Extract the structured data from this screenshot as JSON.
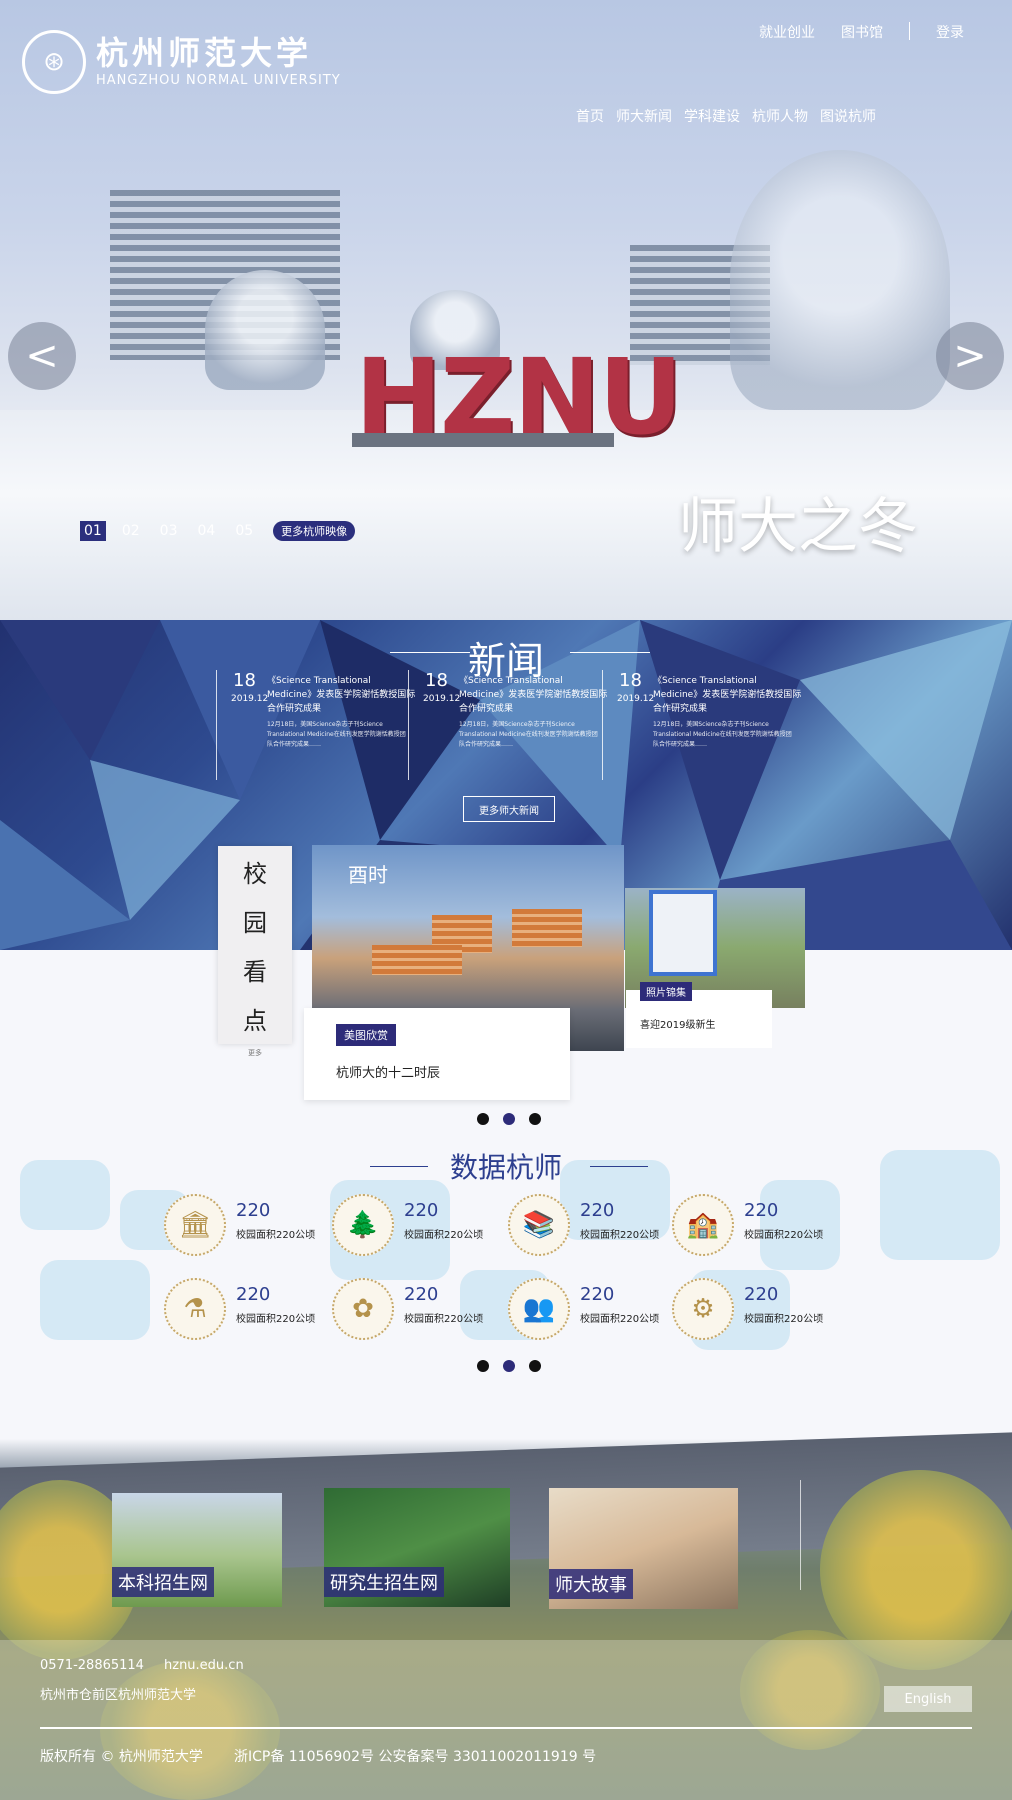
{
  "header": {
    "logo_cn": "杭州师范大学",
    "logo_en": "HANGZHOU NORMAL UNIVERSITY",
    "top_links": [
      "就业创业",
      "图书馆",
      "登录"
    ],
    "nav": [
      "首页",
      "师大新闻",
      "学科建设",
      "杭师人物",
      "图说杭师"
    ]
  },
  "hero": {
    "sign": "HZNU",
    "caption": "师大之冬",
    "prev": "<",
    "next": ">",
    "slides": [
      "01",
      "02",
      "03",
      "04",
      "05"
    ],
    "active_slide": "01",
    "more": "更多杭师映像"
  },
  "news": {
    "title": "新闻",
    "items": [
      {
        "day": "18",
        "ym": "2019.12",
        "headline": "《Science Translational Medicine》发表医学院谢恬教授国际合作研究成果",
        "body": "12月18日，美国Science杂志子刊Science Translational Medicine在线刊发医学院谢恬教授团队合作研究成果……"
      },
      {
        "day": "18",
        "ym": "2019.12",
        "headline": "《Science Translational Medicine》发表医学院谢恬教授国际合作研究成果",
        "body": "12月18日，美国Science杂志子刊Science Translational Medicine在线刊发医学院谢恬教授团队合作研究成果……"
      },
      {
        "day": "18",
        "ym": "2019.12",
        "headline": "《Science Translational Medicine》发表医学院谢恬教授国际合作研究成果",
        "body": "12月18日，美国Science杂志子刊Science Translational Medicine在线刊发医学院谢恬教授团队合作研究成果……"
      }
    ],
    "more": "更多师大新闻"
  },
  "campus": {
    "title_chars": [
      "校",
      "园",
      "看",
      "点"
    ],
    "more": "更多",
    "photo_overlay": "酉时",
    "card1": {
      "tag": "美图欣赏",
      "title": "杭师大的十二时辰"
    },
    "card2": {
      "tag": "照片锦集",
      "title": "喜迎2019级新生"
    }
  },
  "data": {
    "title": "数据杭师",
    "stats": [
      {
        "num": "220",
        "label": "校园面积220公顷",
        "icon": "building-icon",
        "glyph": "🏛"
      },
      {
        "num": "220",
        "label": "校园面积220公顷",
        "icon": "tree-icon",
        "glyph": "🌲"
      },
      {
        "num": "220",
        "label": "校园面积220公顷",
        "icon": "library-icon",
        "glyph": "📚"
      },
      {
        "num": "220",
        "label": "校园面积220公顷",
        "icon": "campus-icon",
        "glyph": "🏫"
      },
      {
        "num": "220",
        "label": "校园面积220公顷",
        "icon": "lab-icon",
        "glyph": "⚗"
      },
      {
        "num": "220",
        "label": "校园面积220公顷",
        "icon": "flower-icon",
        "glyph": "✿"
      },
      {
        "num": "220",
        "label": "校园面积220公顷",
        "icon": "people-icon",
        "glyph": "👥"
      },
      {
        "num": "220",
        "label": "校园面积220公顷",
        "icon": "science-icon",
        "glyph": "⚙"
      }
    ]
  },
  "bottom": {
    "tiles": [
      "本科招生网",
      "研究生招生网",
      "师大故事"
    ]
  },
  "footer": {
    "phone": "0571-28865114",
    "site": "hznu.edu.cn",
    "address": "杭州市仓前区杭州师范大学",
    "english": "English",
    "copyright": "版权所有 © 杭州师范大学",
    "icp": "浙ICP备 11056902号 公安备案号 33011002011919 号"
  },
  "colors": {
    "brand": "#2d2b79",
    "accent_gold": "#c6a86a",
    "sign_red": "#b23345"
  }
}
